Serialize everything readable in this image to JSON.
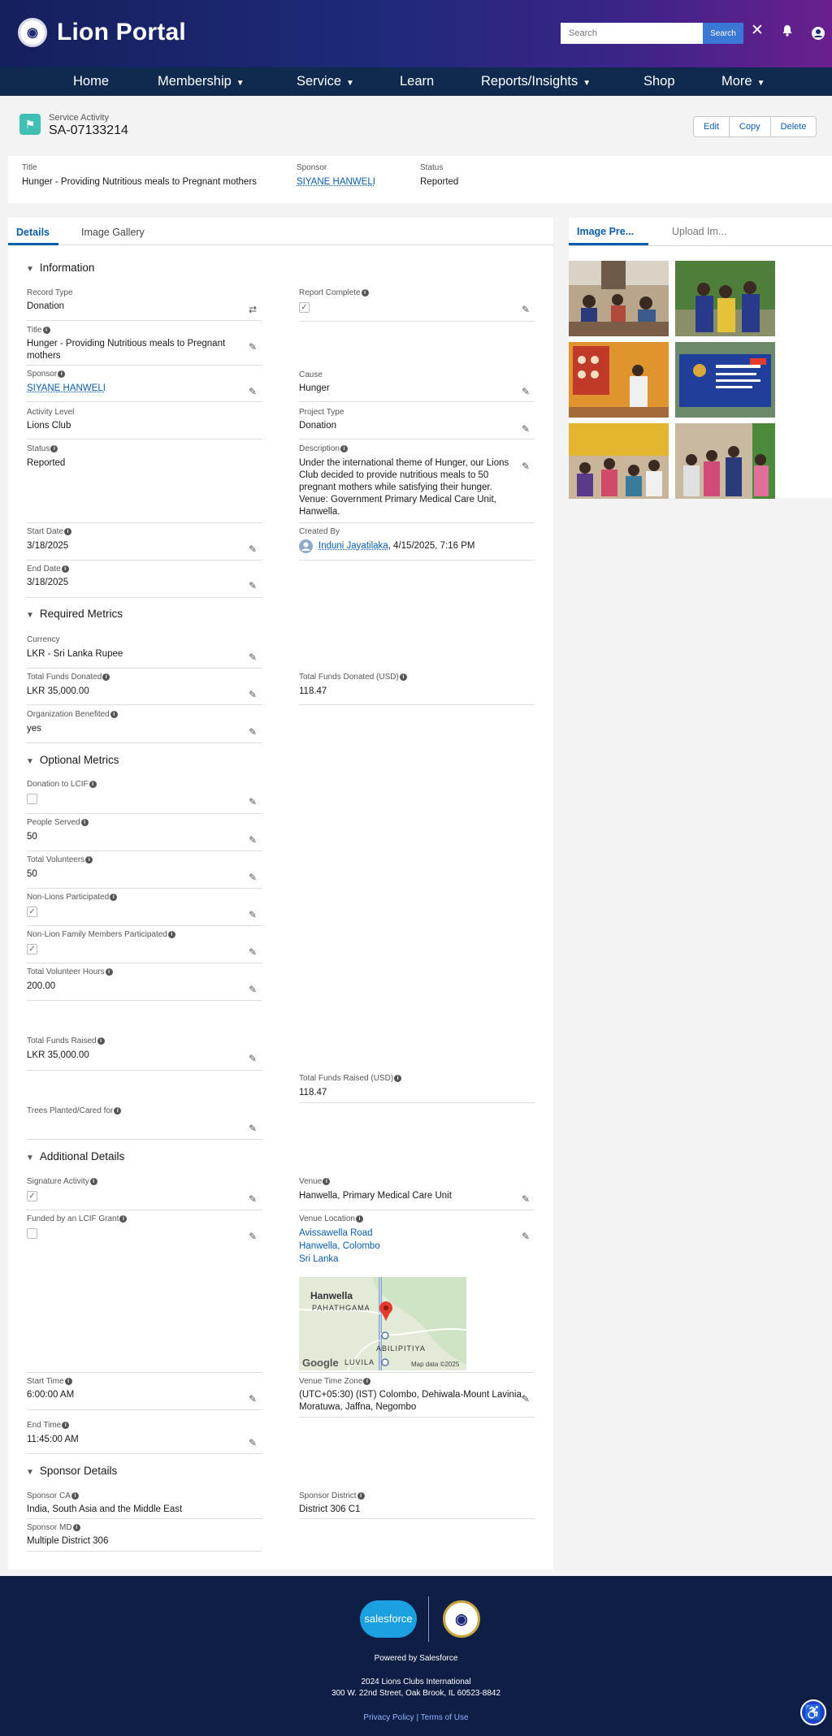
{
  "header": {
    "app_title": "Lion Portal",
    "logo_text": "LIONS",
    "search_placeholder": "Search",
    "search_button": "Search"
  },
  "nav": {
    "home": "Home",
    "membership": "Membership",
    "service": "Service",
    "learn": "Learn",
    "reports": "Reports/Insights",
    "shop": "Shop",
    "more": "More"
  },
  "record": {
    "object_type": "Service Activity",
    "name": "SA-07133214",
    "actions": {
      "edit": "Edit",
      "copy": "Copy",
      "delete": "Delete"
    }
  },
  "highlights": {
    "title_label": "Title",
    "title_value": "Hunger - Providing Nutritious meals to Pregnant mothers",
    "sponsor_label": "Sponsor",
    "sponsor_value": "SIYANE HANWELI",
    "status_label": "Status",
    "status_value": "Reported"
  },
  "tabs": {
    "details": "Details",
    "gallery": "Image Gallery"
  },
  "sections": {
    "information": "Information",
    "required": "Required Metrics",
    "optional": "Optional Metrics",
    "additional": "Additional Details",
    "sponsor": "Sponsor Details"
  },
  "fields": {
    "record_type": {
      "label": "Record Type",
      "value": "Donation"
    },
    "report_complete": {
      "label": "Report Complete",
      "checked": true
    },
    "title": {
      "label": "Title",
      "value1": "Hunger - Providing Nutritious meals to Pregnant",
      "value2": "mothers"
    },
    "sponsor": {
      "label": "Sponsor",
      "value": "SIYANE HANWELI"
    },
    "cause": {
      "label": "Cause",
      "value": "Hunger"
    },
    "activity_level": {
      "label": "Activity Level",
      "value": "Lions Club"
    },
    "project_type": {
      "label": "Project Type",
      "value": "Donation"
    },
    "status": {
      "label": "Status",
      "value": "Reported"
    },
    "description": {
      "label": "Description",
      "l1": "Under the international theme of Hunger, our Lions",
      "l2": "Club decided to provide nutritious meals to 50",
      "l3": "pregnant mothers while satisfying their hunger.",
      "l4": "Venue: Government Primary Medical Care Unit,",
      "l5": "Hanwella."
    },
    "start_date": {
      "label": "Start Date",
      "value": "3/18/2025"
    },
    "created_by": {
      "label": "Created By",
      "name": "Induni Jayatilaka",
      "date": ", 4/15/2025, 7:16 PM"
    },
    "end_date": {
      "label": "End Date",
      "value": "3/18/2025"
    },
    "currency": {
      "label": "Currency",
      "value": "LKR - Sri Lanka Rupee"
    },
    "total_funds_donated": {
      "label": "Total Funds Donated",
      "value": "LKR 35,000.00"
    },
    "total_funds_donated_usd": {
      "label": "Total Funds Donated (USD)",
      "value": "118.47"
    },
    "org_benefited": {
      "label": "Organization Benefited",
      "value": "yes"
    },
    "donation_lcif": {
      "label": "Donation to LCIF",
      "checked": false
    },
    "people_served": {
      "label": "People Served",
      "value": "50"
    },
    "total_volunteers": {
      "label": "Total Volunteers",
      "value": "50"
    },
    "non_lions": {
      "label": "Non-Lions Participated",
      "checked": true
    },
    "non_lion_family": {
      "label": "Non-Lion Family Members Participated",
      "checked": true
    },
    "volunteer_hours": {
      "label": "Total Volunteer Hours",
      "value": "200.00"
    },
    "funds_raised": {
      "label": "Total Funds Raised",
      "value": "LKR 35,000.00"
    },
    "funds_raised_usd": {
      "label": "Total Funds Raised (USD)",
      "value": "118.47"
    },
    "trees": {
      "label": "Trees Planted/Cared for",
      "value": ""
    },
    "signature": {
      "label": "Signature Activity",
      "checked": true
    },
    "venue": {
      "label": "Venue",
      "value": "Hanwella, Primary Medical Care Unit"
    },
    "lcif_grant": {
      "label": "Funded by an LCIF Grant",
      "checked": false
    },
    "venue_location": {
      "label": "Venue Location",
      "l1": "Avissawella Road",
      "l2": "Hanwella, Colombo",
      "l3": "Sri Lanka"
    },
    "start_time": {
      "label": "Start Time",
      "value": "6:00:00 AM"
    },
    "venue_tz": {
      "label": "Venue Time Zone",
      "l1": "(UTC+05:30) (IST) Colombo, Dehiwala-Mount Lavinia,",
      "l2": "Moratuwa, Jaffna, Negombo"
    },
    "end_time": {
      "label": "End Time",
      "value": "11:45:00 AM"
    },
    "sponsor_ca": {
      "label": "Sponsor CA",
      "value": "India, South Asia and the Middle East"
    },
    "sponsor_district": {
      "label": "Sponsor District",
      "value": "District 306 C1"
    },
    "sponsor_md": {
      "label": "Sponsor MD",
      "value": "Multiple District 306"
    }
  },
  "map": {
    "town1": "Hanwella",
    "town2": "PAHATHGAMA",
    "town3": "ABILIPITIYA",
    "town4": "LUVILA",
    "brand": "Google",
    "attrib": "Map data ©2025"
  },
  "right_tabs": {
    "preview": "Image Pre...",
    "upload": "Upload Im..."
  },
  "footer": {
    "powered": "Powered by Salesforce",
    "sf_logo": "salesforce",
    "org": "2024 Lions Clubs International",
    "address": "300 W. 22nd Street, Oak Brook, IL 60523-8842",
    "privacy": "Privacy Policy",
    "terms": "Terms of Use",
    "sep": " | "
  }
}
